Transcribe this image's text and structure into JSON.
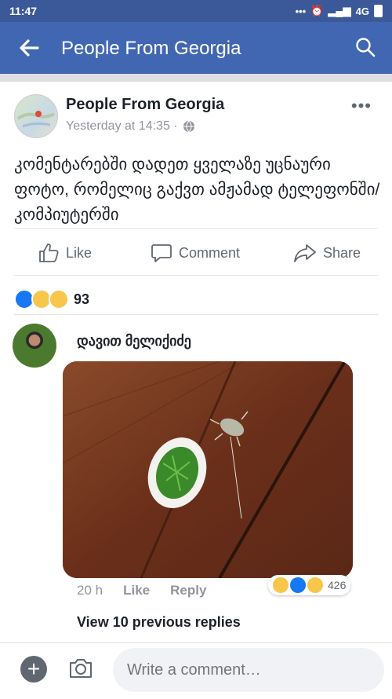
{
  "status_bar": {
    "time": "11:47",
    "network": "4G"
  },
  "app_bar": {
    "title": "People From Georgia"
  },
  "post": {
    "page_name": "People From Georgia",
    "timestamp": "Yesterday at 14:35 ·",
    "text": "კომენტარებში დადეთ ყველაზე უცნაური ფოტო, რომელიც გაქვთ ამჟამად ტელეფონში/კომპიუტერში",
    "actions": {
      "like": "Like",
      "comment": "Comment",
      "share": "Share"
    },
    "reaction_count": "93"
  },
  "comment": {
    "author": "დავით მელიქიძე",
    "time": "20 h",
    "like_label": "Like",
    "reply_label": "Reply",
    "reaction_count": "426"
  },
  "view_previous": "View 10 previous replies",
  "composer": {
    "placeholder": "Write a comment…"
  },
  "colors": {
    "brand": "#4267b2",
    "statusbar": "#3b5998",
    "like_blue": "#1877f2",
    "haha_yellow": "#f7c64a"
  }
}
